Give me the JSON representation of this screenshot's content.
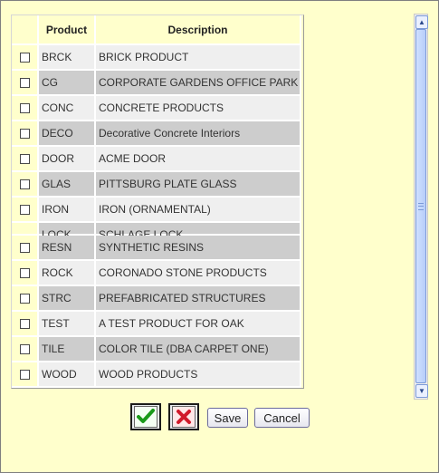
{
  "table": {
    "columns": [
      "",
      "Product",
      "Description"
    ],
    "rows": [
      {
        "code": "BRCK",
        "description": "BRICK PRODUCT"
      },
      {
        "code": "CG",
        "description": "CORPORATE GARDENS OFFICE PARK"
      },
      {
        "code": "CONC",
        "description": "CONCRETE PRODUCTS"
      },
      {
        "code": "DECO",
        "description": "Decorative Concrete Interiors"
      },
      {
        "code": "DOOR",
        "description": "ACME DOOR"
      },
      {
        "code": "GLAS",
        "description": "PITTSBURG PLATE GLASS"
      },
      {
        "code": "IRON",
        "description": "IRON (ORNAMENTAL)"
      },
      {
        "code": "LOCK",
        "description": "SCHLAGE LOCK"
      },
      {
        "code": "RESN",
        "description": "SYNTHETIC RESINS"
      },
      {
        "code": "ROCK",
        "description": "CORONADO STONE PRODUCTS"
      },
      {
        "code": "STRC",
        "description": "PREFABRICATED STRUCTURES"
      },
      {
        "code": "TEST",
        "description": "A TEST PRODUCT FOR OAK"
      },
      {
        "code": "TILE",
        "description": "COLOR TILE (DBA CARPET ONE)"
      },
      {
        "code": "WOOD",
        "description": "WOOD PRODUCTS"
      }
    ]
  },
  "buttons": {
    "save": "Save",
    "cancel": "Cancel"
  },
  "icons": {
    "confirm": "checkmark-icon",
    "reject": "x-icon"
  },
  "colors": {
    "background": "#ffffcc",
    "row_light": "#efefef",
    "row_dark": "#cdcdcd",
    "confirm": "#1a9a1a",
    "reject": "#d11a2a"
  }
}
